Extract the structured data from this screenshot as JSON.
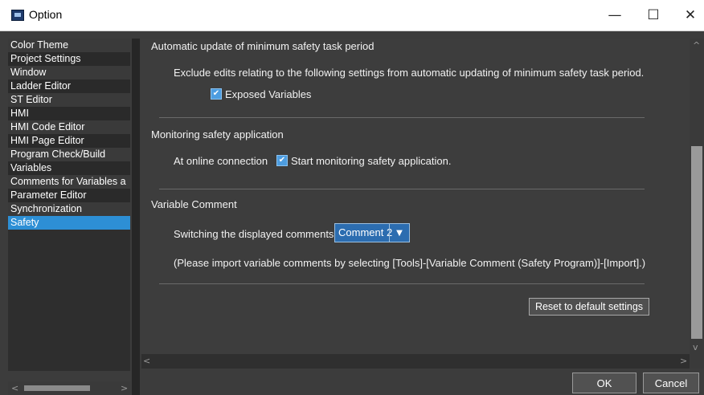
{
  "window": {
    "title": "Option",
    "minimize_icon": "—",
    "maximize_icon": "☐",
    "close_icon": "✕"
  },
  "sidebar": {
    "items": [
      {
        "label": "Color Theme"
      },
      {
        "label": "Project Settings"
      },
      {
        "label": "Window"
      },
      {
        "label": "Ladder Editor"
      },
      {
        "label": "ST Editor"
      },
      {
        "label": "HMI"
      },
      {
        "label": "HMI Code Editor"
      },
      {
        "label": "HMI Page Editor"
      },
      {
        "label": "Program Check/Build"
      },
      {
        "label": "Variables"
      },
      {
        "label": "Comments for Variables a"
      },
      {
        "label": "Parameter Editor"
      },
      {
        "label": "Synchronization"
      },
      {
        "label": "Safety",
        "selected": true
      }
    ]
  },
  "content": {
    "auto_update": {
      "title": "Automatic update of minimum safety task period",
      "description": "Exclude edits relating to the following settings from automatic updating of minimum safety task period.",
      "exposed_variables_label": "Exposed Variables",
      "exposed_variables_checked": true
    },
    "monitoring": {
      "title": "Monitoring safety application",
      "online_label": "At online connection",
      "start_monitoring_label": "Start monitoring safety application.",
      "start_monitoring_checked": true
    },
    "variable_comment": {
      "title": "Variable Comment",
      "switch_label": "Switching the displayed comments:",
      "selected_comment": "Comment 2",
      "note": "(Please import variable comments by selecting [Tools]-[Variable Comment (Safety Program)]-[Import].)"
    },
    "reset_button": "Reset to default settings",
    "check_glyph": "✔",
    "dropdown_glyph": "▼"
  },
  "footer": {
    "ok": "OK",
    "cancel": "Cancel"
  },
  "colors": {
    "selected_item": "#2d8fd5",
    "background": "#3d3d3d"
  }
}
